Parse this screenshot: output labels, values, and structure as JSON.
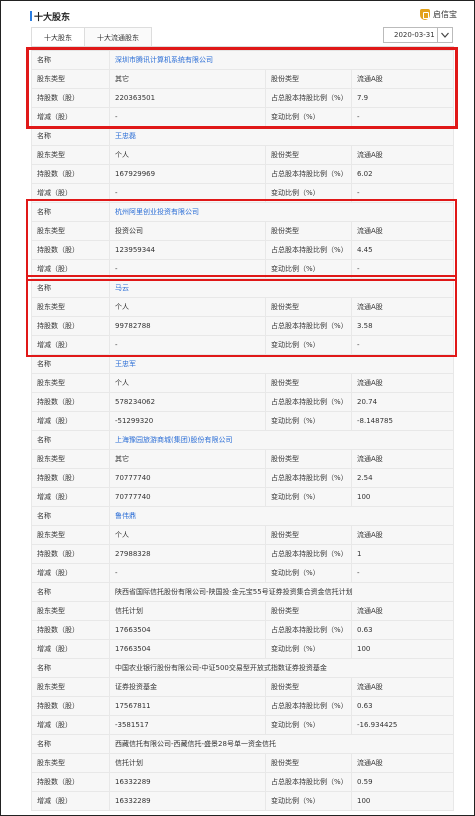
{
  "header": {
    "title": "十大股东",
    "brand": "启信宝"
  },
  "tabs": [
    {
      "label": "十大股东"
    },
    {
      "label": "十大流通股东"
    }
  ],
  "date_select": {
    "value": "2020-03-31"
  },
  "labels": {
    "name": "名称",
    "holder_type": "股东类型",
    "shares": "持股数（股）",
    "change": "增减（股）",
    "share_type": "股份类型",
    "ratio": "占总股本持股比例（%）",
    "change_ratio": "变动比例（%）"
  },
  "shareholders": [
    {
      "name": "深圳市腾讯计算机系统有限公司",
      "link": true,
      "holder_type": "其它",
      "share_type": "流通A股",
      "shares": "220363501",
      "ratio": "7.9",
      "change": "-",
      "change_ratio": "-"
    },
    {
      "name": "王忠磊",
      "link": true,
      "holder_type": "个人",
      "share_type": "流通A股",
      "shares": "167929969",
      "ratio": "6.02",
      "change": "-",
      "change_ratio": "-"
    },
    {
      "name": "杭州阿里创业投资有限公司",
      "link": true,
      "holder_type": "投资公司",
      "share_type": "流通A股",
      "shares": "123959344",
      "ratio": "4.45",
      "change": "-",
      "change_ratio": "-"
    },
    {
      "name": "马云",
      "link": true,
      "holder_type": "个人",
      "share_type": "流通A股",
      "shares": "99782788",
      "ratio": "3.58",
      "change": "-",
      "change_ratio": "-"
    },
    {
      "name": "王忠军",
      "link": true,
      "holder_type": "个人",
      "share_type": "流通A股",
      "shares": "578234062",
      "ratio": "20.74",
      "change": "-51299320",
      "change_ratio": "-8.148785"
    },
    {
      "name": "上海豫园旅游商城(集团)股份有限公司",
      "link": true,
      "holder_type": "其它",
      "share_type": "流通A股",
      "shares": "70777740",
      "ratio": "2.54",
      "change": "70777740",
      "change_ratio": "100"
    },
    {
      "name": "鲁伟鼎",
      "link": true,
      "holder_type": "个人",
      "share_type": "流通A股",
      "shares": "27988328",
      "ratio": "1",
      "change": "-",
      "change_ratio": "-"
    },
    {
      "name": "陕西省国际信托股份有限公司-陕国投·金元宝55号证券投资集合资金信托计划",
      "link": false,
      "holder_type": "信托计划",
      "share_type": "流通A股",
      "shares": "17663504",
      "ratio": "0.63",
      "change": "17663504",
      "change_ratio": "100"
    },
    {
      "name": "中国农业银行股份有限公司-中证500交易型开放式指数证券投资基金",
      "link": false,
      "holder_type": "证券投资基金",
      "share_type": "流通A股",
      "shares": "17567811",
      "ratio": "0.63",
      "change": "-3581517",
      "change_ratio": "-16.934425"
    },
    {
      "name": "西藏信托有限公司-西藏信托-盛景28号单一资金信托",
      "link": false,
      "holder_type": "信托计划",
      "share_type": "流通A股",
      "shares": "16332289",
      "ratio": "0.59",
      "change": "16332289",
      "change_ratio": "100"
    }
  ],
  "highlight_color": "#e01818"
}
